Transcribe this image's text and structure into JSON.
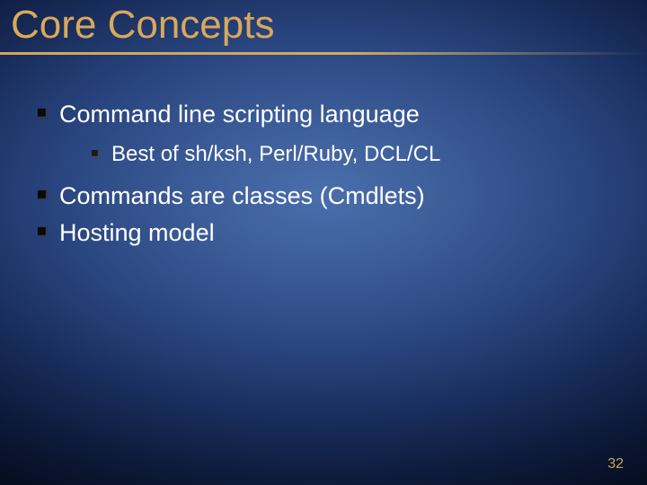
{
  "title": "Core Concepts",
  "bullets": {
    "item1": "Command line scripting language",
    "item1_sub1": "Best of sh/ksh, Perl/Ruby, DCL/CL",
    "item2": "Commands are classes (Cmdlets)",
    "item3": "Hosting model"
  },
  "page_number": "32"
}
